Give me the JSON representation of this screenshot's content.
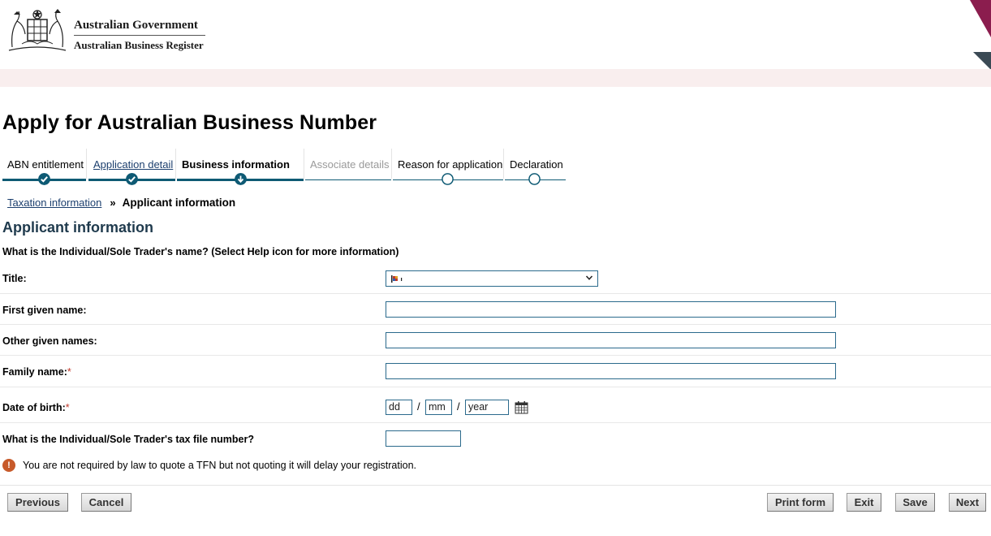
{
  "header": {
    "gov_name": "Australian Government",
    "agency_name": "Australian Business Register"
  },
  "page_title": "Apply for Australian Business Number",
  "steps": [
    {
      "label": "ABN entitlement",
      "state": "done"
    },
    {
      "label": "Application detail",
      "state": "done-link"
    },
    {
      "label": "Business information",
      "state": "current"
    },
    {
      "label": "Associate details",
      "state": "disabled"
    },
    {
      "label": "Reason for application",
      "state": "pending"
    },
    {
      "label": "Declaration",
      "state": "pending"
    }
  ],
  "breadcrumb": {
    "parent": "Taxation information",
    "separator": "»",
    "current": "Applicant information"
  },
  "section_title": "Applicant information",
  "question": "What is the Individual/Sole Trader's name? (Select Help icon for more information)",
  "fields": {
    "title_label": "Title:",
    "first_name_label": "First given name:",
    "other_names_label": "Other given names:",
    "family_name_label": "Family name:",
    "required_mark": "*",
    "dob_label": "Date of birth:",
    "dob_day": "dd",
    "dob_month": "mm",
    "dob_year": "year",
    "dob_sep": "/",
    "tfn_label": "What is the Individual/Sole Trader's tax file number?"
  },
  "notice": "You are not required by law to quote a TFN but not quoting it will delay your registration.",
  "notice_icon": "!",
  "buttons": {
    "previous": "Previous",
    "cancel": "Cancel",
    "print": "Print form",
    "exit": "Exit",
    "save": "Save",
    "next": "Next"
  },
  "colors": {
    "accent": "#0e5a74",
    "band": "#f9eeee",
    "corner_magenta": "#8b1d4e",
    "warning": "#c75a2a"
  }
}
